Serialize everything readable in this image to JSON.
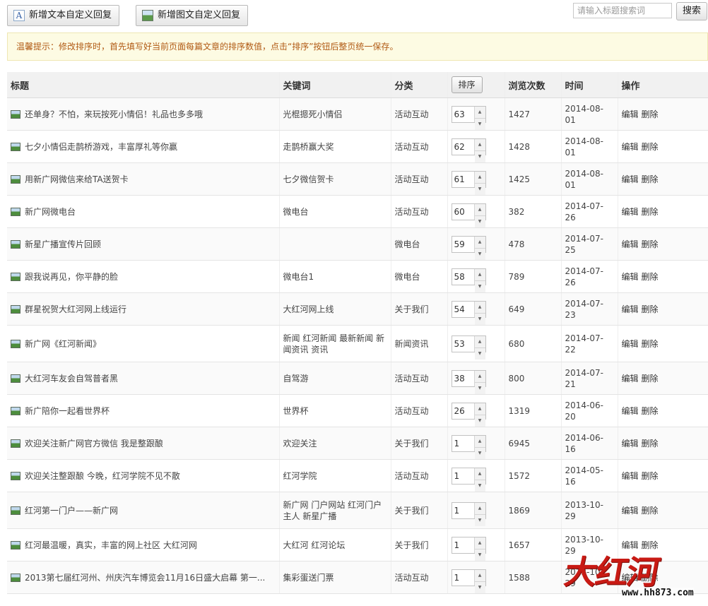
{
  "toolbar": {
    "add_text_label": "新增文本自定义回复",
    "add_pic_label": "新增图文自定义回复"
  },
  "search": {
    "placeholder": "请输入标题搜索词",
    "button_label": "搜索"
  },
  "notice": {
    "text": "温馨提示：修改排序时，首先填写好当前页面每篇文章的排序数值，点击“排序”按钮后整页统一保存。"
  },
  "table": {
    "headers": {
      "title": "标题",
      "keyword": "关键词",
      "category": "分类",
      "sort_button": "排序",
      "views": "浏览次数",
      "time": "时间",
      "actions": "操作"
    },
    "action_labels": {
      "edit": "编辑",
      "delete": "删除"
    },
    "rows": [
      {
        "title": "还单身？不怕，来玩按死小情侣！礼品也多多哦",
        "keyword": "光棍摁死小情侣",
        "category": "活动互动",
        "sort": "63",
        "views": "1427",
        "time": "2014-08-01"
      },
      {
        "title": "七夕小情侣走鹊桥游戏，丰富厚礼等你赢",
        "keyword": "走鹊桥赢大奖",
        "category": "活动互动",
        "sort": "62",
        "views": "1428",
        "time": "2014-08-01"
      },
      {
        "title": "用新广网微信来给TA送贺卡",
        "keyword": "七夕微信贺卡",
        "category": "活动互动",
        "sort": "61",
        "views": "1425",
        "time": "2014-08-01"
      },
      {
        "title": "新广网微电台",
        "keyword": "微电台",
        "category": "活动互动",
        "sort": "60",
        "views": "382",
        "time": "2014-07-26"
      },
      {
        "title": "新星广播宣传片回顾",
        "keyword": "",
        "category": "微电台",
        "sort": "59",
        "views": "478",
        "time": "2014-07-25"
      },
      {
        "title": "跟我说再见，你平静的脸",
        "keyword": "微电台1",
        "category": "微电台",
        "sort": "58",
        "views": "789",
        "time": "2014-07-26"
      },
      {
        "title": "群星祝贺大红河网上线运行",
        "keyword": "大红河网上线",
        "category": "关于我们",
        "sort": "54",
        "views": "649",
        "time": "2014-07-23"
      },
      {
        "title": "新广网《红河新闻》",
        "keyword": "新闻 红河新闻 最新新闻 新闻资讯 资讯",
        "category": "新闻资讯",
        "sort": "53",
        "views": "680",
        "time": "2014-07-22"
      },
      {
        "title": "大红河车友会自驾普者黑",
        "keyword": "自驾游",
        "category": "活动互动",
        "sort": "38",
        "views": "800",
        "time": "2014-07-21"
      },
      {
        "title": "新广陪你一起看世界杯",
        "keyword": "世界杯",
        "category": "活动互动",
        "sort": "26",
        "views": "1319",
        "time": "2014-06-20"
      },
      {
        "title": "欢迎关注新广网官方微信 我是整跟酿",
        "keyword": "欢迎关注",
        "category": "关于我们",
        "sort": "1",
        "views": "6945",
        "time": "2014-06-16"
      },
      {
        "title": "欢迎关注整跟酿 今晚，红河学院不见不散",
        "keyword": "红河学院",
        "category": "活动互动",
        "sort": "1",
        "views": "1572",
        "time": "2014-05-16"
      },
      {
        "title": "红河第一门户——新广网",
        "keyword": "新广网 门户网站 红河门户 主人 新星广播",
        "category": "关于我们",
        "sort": "1",
        "views": "1869",
        "time": "2013-10-29"
      },
      {
        "title": "红河最温暖，真实，丰富的网上社区 大红河网",
        "keyword": "大红河 红河论坛",
        "category": "关于我们",
        "sort": "1",
        "views": "1657",
        "time": "2013-10-29"
      },
      {
        "title": "2013第七届红河州、州庆汽车博览会11月16日盛大启幕 第一...",
        "keyword": "集彩蛋送门票",
        "category": "活动互动",
        "sort": "1",
        "views": "1588",
        "time": "2013-10-29"
      }
    ]
  },
  "watermark": {
    "logo_text": "大红河",
    "url": "www.hh873.com",
    "color": "#c81a14"
  },
  "colors": {
    "notice_text": "#b15a14",
    "notice_bg": "#fdfbe3",
    "header_bg": "#f1f1f1"
  }
}
